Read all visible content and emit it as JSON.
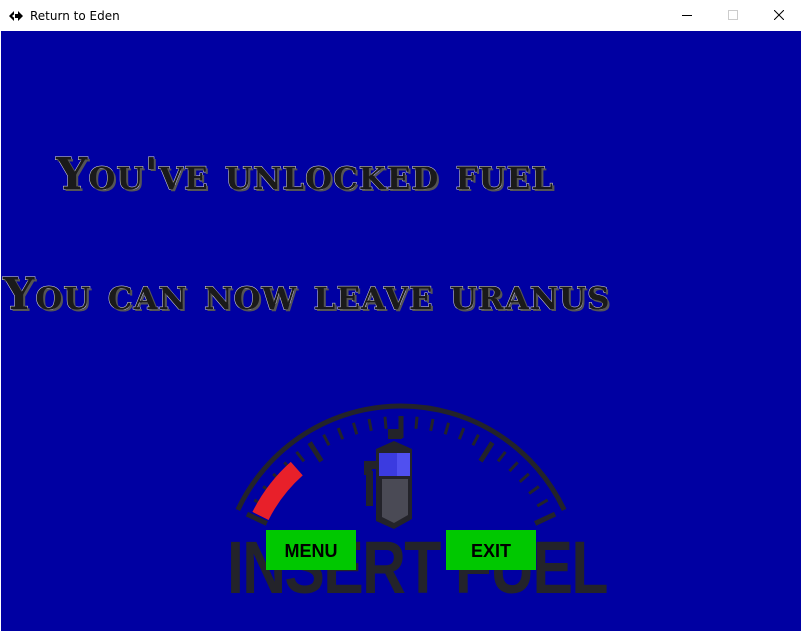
{
  "window": {
    "title": "Return to Eden"
  },
  "game": {
    "headline_1": "You've unlocked fuel",
    "headline_2": "You can now leave uranus",
    "gauge_label": "INSERT FUEL",
    "fuel_level_fraction": 0.18,
    "buttons": {
      "menu": "MENU",
      "exit": "EXIT"
    }
  },
  "colors": {
    "background": "#0000a2",
    "button": "#00c800",
    "gauge_red": "#e8202a",
    "gauge_dark": "#23232a"
  },
  "icons": {
    "app": "app-icon",
    "minimize": "minimize-icon",
    "maximize": "maximize-icon",
    "close": "close-icon",
    "fuel_pump": "fuel-pump-icon"
  }
}
